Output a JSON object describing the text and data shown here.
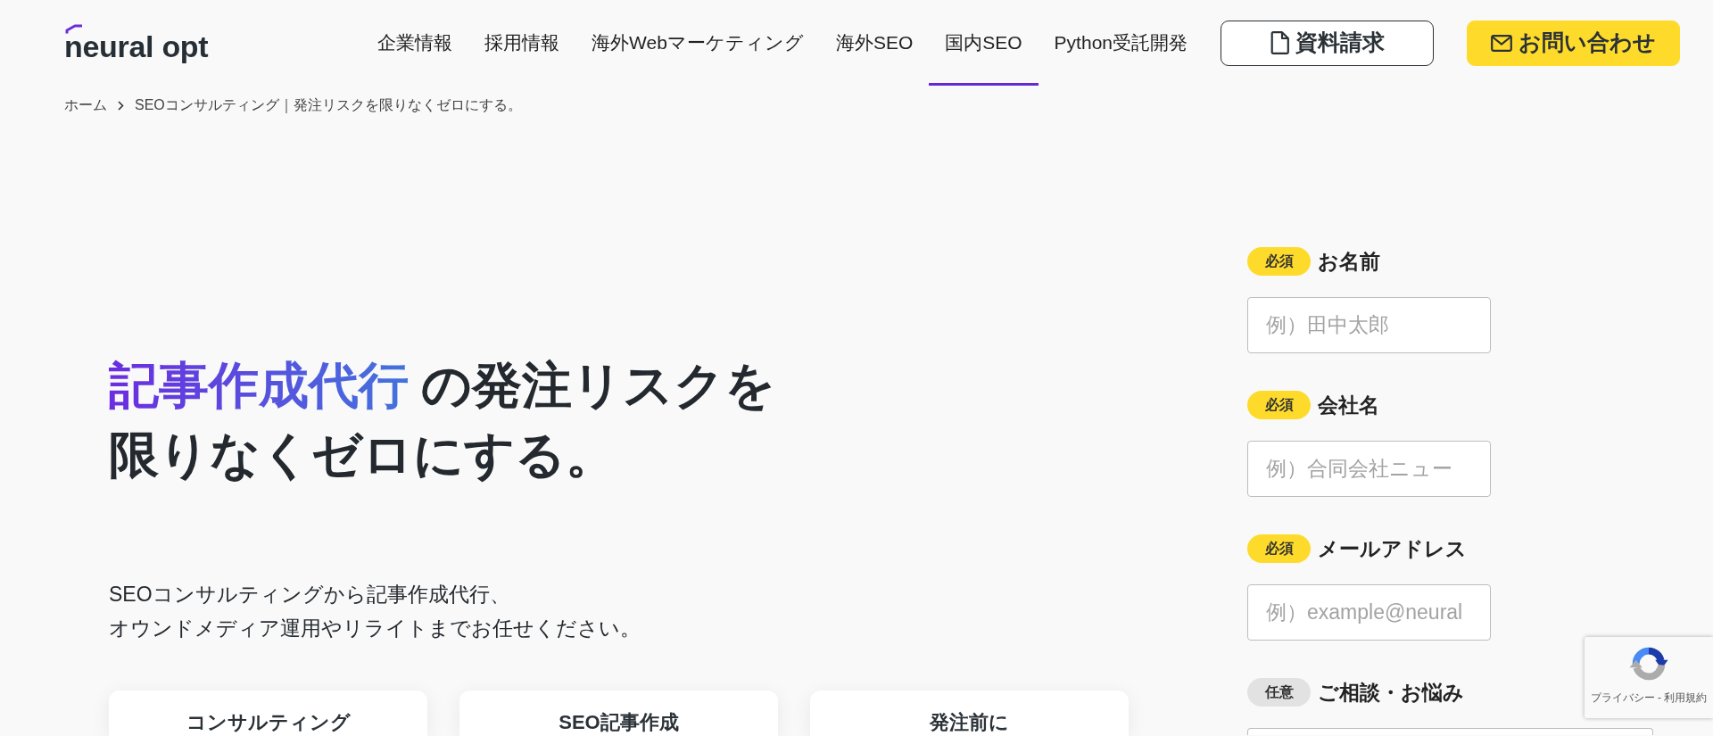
{
  "header": {
    "logo": "neural opt",
    "nav": [
      {
        "label": "企業情報",
        "selected": false
      },
      {
        "label": "採用情報",
        "selected": false
      },
      {
        "label": "海外Webマーケティング",
        "selected": false
      },
      {
        "label": "海外SEO",
        "selected": false
      },
      {
        "label": "国内SEO",
        "selected": true
      },
      {
        "label": "Python受託開発",
        "selected": false
      }
    ],
    "buttons": [
      {
        "label": "資料請求",
        "kind": "outline"
      },
      {
        "label": "お問い合わせ",
        "kind": "primary"
      }
    ]
  },
  "breadcrumb": [
    "ホーム",
    "SEOコンサルティング｜発注リスクを限りなくゼロにする。"
  ],
  "hero": {
    "headline": {
      "highlight": "記事作成代行",
      "rest": [
        "の発注リスクを",
        "限りなくゼロにする。"
      ]
    },
    "lead": [
      "SEOコンサルティングから記事作成代行、",
      "オウンドメディア運用やリライトまでお任せください。"
    ],
    "cards": [
      {
        "title": "コンサルティング"
      },
      {
        "title": "SEO記事作成"
      },
      {
        "title": "発注前に"
      }
    ]
  },
  "form": {
    "fields": [
      {
        "badge": "必須",
        "required": true,
        "label": "お名前",
        "kind": "text",
        "placeholder": "例）田中太郎"
      },
      {
        "badge": "必須",
        "required": true,
        "label": "会社名",
        "kind": "text",
        "placeholder": "例）合同会社ニュー"
      },
      {
        "badge": "必須",
        "required": true,
        "label": "メールアドレス",
        "kind": "text",
        "placeholder": "例）example@neural"
      },
      {
        "badge": "任意",
        "required": false,
        "label": "ご相談・お悩み",
        "kind": "textarea"
      }
    ]
  },
  "recaptcha": {
    "links": [
      "プライバシー",
      "利用規約"
    ],
    "separator": "-"
  }
}
